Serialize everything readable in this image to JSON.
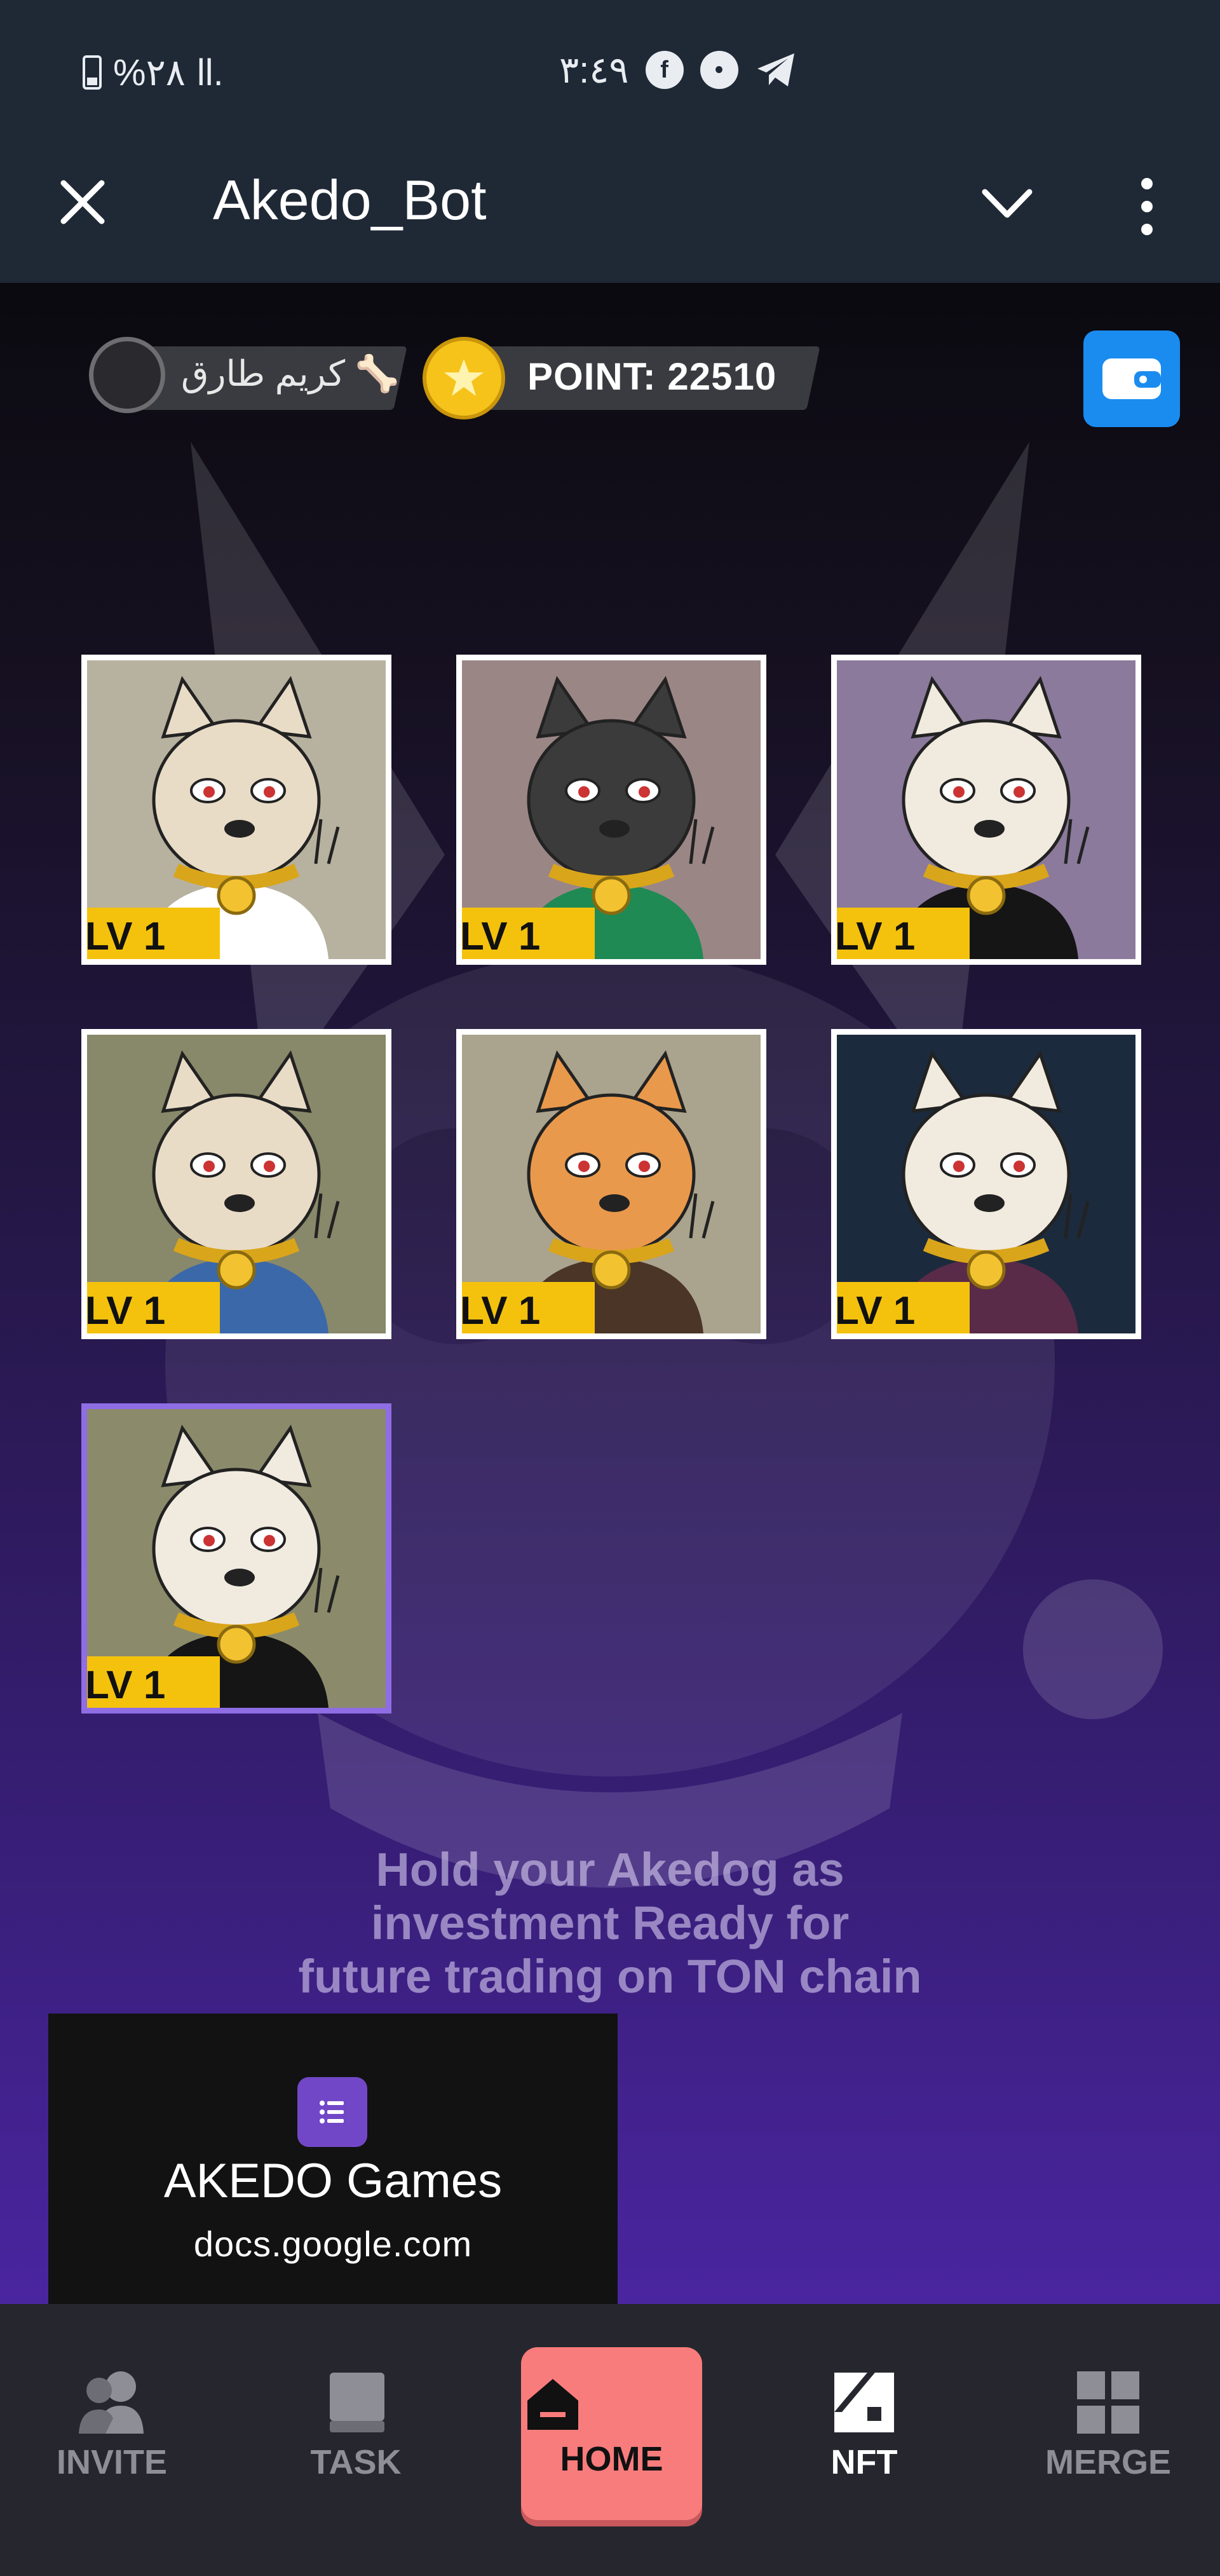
{
  "status_bar": {
    "battery": "%٢٨",
    "signal": "ll.",
    "time": "٣:٤٩"
  },
  "title_bar": {
    "title": "Akedo_Bot"
  },
  "player": {
    "name": "كريم طارق 🦴"
  },
  "points": {
    "label": "POINT: 22510"
  },
  "nft_grid": {
    "cards": [
      {
        "level": "LV 1",
        "bg": "#b7b19f",
        "fur": "#e9dcc7",
        "shirt": "#ffffff"
      },
      {
        "level": "LV 1",
        "bg": "#9b8686",
        "fur": "#3b3b3b",
        "shirt": "#1f8a53"
      },
      {
        "level": "LV 1",
        "bg": "#8b7a9c",
        "fur": "#f1eadf",
        "shirt": "#151515"
      },
      {
        "level": "LV 1",
        "bg": "#88886a",
        "fur": "#e9dcc7",
        "shirt": "#3b68a8"
      },
      {
        "level": "LV 1",
        "bg": "#aaa38d",
        "fur": "#e9994c",
        "shirt": "#4a3526"
      },
      {
        "level": "LV 1",
        "bg": "#1c2a3d",
        "fur": "#f1eadf",
        "shirt": "#5a2b48"
      },
      {
        "level": "LV 1",
        "bg": "#8b8b6c",
        "fur": "#f1eadf",
        "shirt": "#151515"
      }
    ]
  },
  "promo_text": {
    "line1": "Hold your Akedog as",
    "line2": "investment Ready for",
    "line3": "future trading on TON chain"
  },
  "toast": {
    "title": "AKEDO Games",
    "url": "docs.google.com"
  },
  "bottom_nav": {
    "items": [
      {
        "label": "INVITE",
        "icon": "people-icon"
      },
      {
        "label": "TASK",
        "icon": "book-icon"
      },
      {
        "label": "HOME",
        "icon": "home-icon"
      },
      {
        "label": "NFT",
        "icon": "nft-icon"
      },
      {
        "label": "MERGE",
        "icon": "grid-icon"
      }
    ],
    "active": "HOME"
  },
  "colors": {
    "accent_home": "#f97c7c",
    "level_badge": "#f4c20d",
    "wallet": "#1a8cf0",
    "coin": "#f6c31a"
  }
}
